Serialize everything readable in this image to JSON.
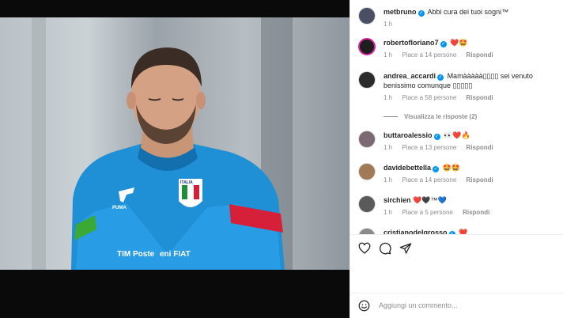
{
  "post": {
    "caption": {
      "username": "metbruno",
      "text": "Abbi cura dei tuoi sogni™",
      "time": "1 h"
    }
  },
  "comments": [
    {
      "username": "robertofloriano7",
      "text": "❤️🤩",
      "time": "1 h",
      "likes": "Piace a 14 persone",
      "reply": "Rispondi"
    },
    {
      "username": "andrea_accardi",
      "text": "Mamààààà▯▯▯▯ sei venuto benissimo comunque ▯▯▯▯▯",
      "time": "1 h",
      "likes": "Piace a 58 persone",
      "reply": "Rispondi",
      "view_replies": "Visualizza le risposte (2)"
    },
    {
      "username": "buttaroalessio",
      "text": "👀❤️🔥",
      "time": "1 h",
      "likes": "Piace a 13 persone",
      "reply": "Rispondi"
    },
    {
      "username": "davidebettella",
      "text": "🤩🤩",
      "time": "1 h",
      "likes": "Piace a 14 persone",
      "reply": "Rispondi"
    },
    {
      "username": "sirchien",
      "text": "❤️🖤™💙",
      "time": "1 h",
      "likes": "Piace a 5 persone",
      "reply": "Rispondi"
    },
    {
      "username": "cristianodelgrosso",
      "text": "❤️"
    }
  ],
  "actions": {
    "like_icon": "heart-icon",
    "comment_icon": "comment-bubble-icon",
    "share_icon": "send-arrow-icon"
  },
  "composer": {
    "placeholder": "Aggiungi un commento...",
    "emoji_icon": "smiley-icon"
  },
  "photo": {
    "jersey_sponsor_left": "TIM Poste",
    "jersey_sponsor_right": "eni FIAT",
    "crest_text": "ITALIA",
    "brand_text": "PUMA"
  }
}
